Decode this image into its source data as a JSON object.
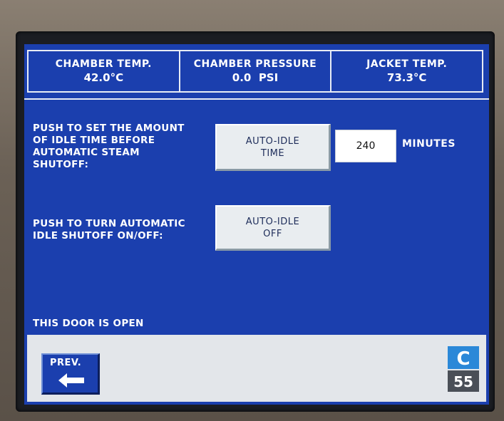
{
  "header": {
    "chamber_temp": {
      "label": "CHAMBER TEMP.",
      "value": "42.0°C"
    },
    "chamber_pressure": {
      "label": "CHAMBER PRESSURE",
      "value": "0.0  PSI"
    },
    "jacket_temp": {
      "label": "JACKET TEMP.",
      "value": "73.3°C"
    }
  },
  "idle_time": {
    "prompt": "PUSH TO SET THE AMOUNT\nOF IDLE TIME BEFORE\nAUTOMATIC STEAM\nSHUTOFF:",
    "button_line1": "AUTO-IDLE",
    "button_line2": "TIME",
    "value": "240",
    "unit": "MINUTES"
  },
  "idle_toggle": {
    "prompt": "PUSH TO TURN AUTOMATIC\nIDLE SHUTOFF ON/OFF:",
    "button_line1": "AUTO-IDLE",
    "button_line2": "OFF"
  },
  "status": "THIS DOOR IS OPEN",
  "footer": {
    "prev_label": "PREV.",
    "logo_top": "C",
    "logo_bottom": "55"
  },
  "colors": {
    "screen": "#1b3fae",
    "footer": "#e3e6ea",
    "button": "#e9edf0"
  },
  "icons": {
    "prev": "left-arrow-icon",
    "logo": "cs-logo-icon"
  }
}
